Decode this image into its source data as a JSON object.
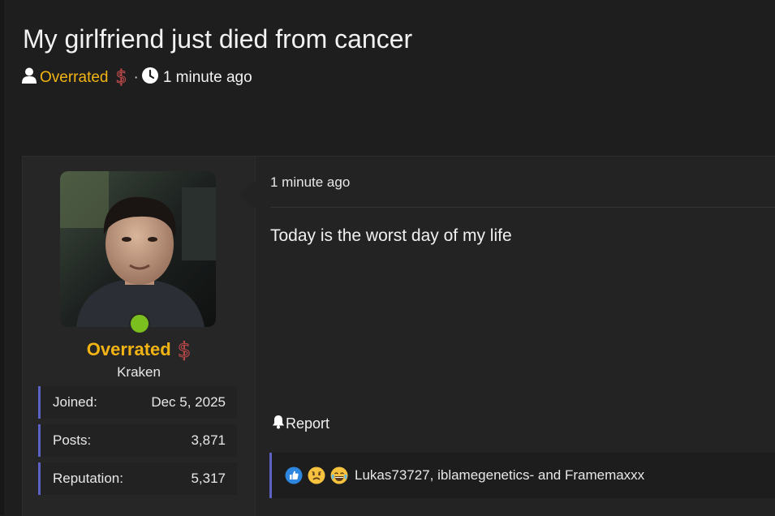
{
  "thread": {
    "title": "My girlfriend just died from cancer",
    "author": "Overrated",
    "separator": "·",
    "time": "1 minute ago"
  },
  "user": {
    "name": "Overrated",
    "title": "Kraken",
    "online": true,
    "stats": [
      {
        "label": "Joined:",
        "value": "Dec 5, 2025"
      },
      {
        "label": "Posts:",
        "value": "3,871"
      },
      {
        "label": "Reputation:",
        "value": "5,317"
      }
    ]
  },
  "post": {
    "time": "1 minute ago",
    "body": "Today is the worst day of my life",
    "report_label": "Report"
  },
  "reactions": {
    "icons": [
      "like-icon",
      "sad-icon",
      "crying-laughing-icon"
    ],
    "names": "Lukas73727, iblamegenetics- and Framemaxxx"
  },
  "colors": {
    "accent_username": "#f2b413",
    "accent_bar": "#5b62c4",
    "online": "#7bbf1e"
  }
}
